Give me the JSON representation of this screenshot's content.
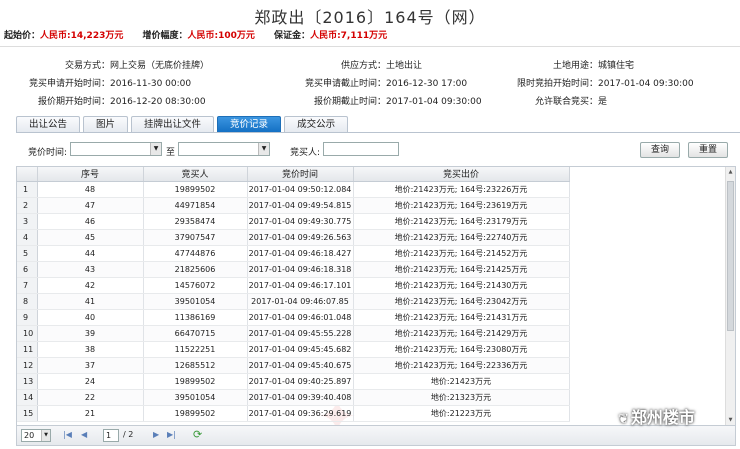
{
  "title": "郑政出〔2016〕164号（网）",
  "summary": {
    "start_price_label": "起始价：",
    "start_price_value": "人民币:14,223万元",
    "increment_label": "增价幅度：",
    "increment_value": "人民币:100万元",
    "deposit_label": "保证金：",
    "deposit_value": "人民币:7,111万元"
  },
  "info": {
    "trade_method_label": "交易方式：",
    "trade_method_value": "网上交易（无底价挂牌）",
    "supply_method_label": "供应方式：",
    "supply_method_value": "土地出让",
    "land_use_label": "土地用途：",
    "land_use_value": "城镇住宅",
    "apply_start_label": "竞买申请开始时间：",
    "apply_start_value": "2016-11-30 00:00",
    "apply_end_label": "竞买申请截止时间：",
    "apply_end_value": "2016-12-30 17:00",
    "timed_start_label": "限时竞拍开始时间：",
    "timed_start_value": "2017-01-04 09:30:00",
    "quote_start_label": "报价期开始时间：",
    "quote_start_value": "2016-12-20 08:30:00",
    "quote_end_label": "报价期截止时间：",
    "quote_end_value": "2017-01-04 09:30:00",
    "joint_label": "允许联合竞买：",
    "joint_value": "是"
  },
  "tabs": [
    "出让公告",
    "图片",
    "挂牌出让文件",
    "竞价记录",
    "成交公示"
  ],
  "active_tab": 3,
  "filter": {
    "time_label": "竞价时间:",
    "to_label": "至",
    "bidder_label": "竞买人:",
    "search_label": "查询",
    "reset_label": "重置"
  },
  "table": {
    "headers": [
      "",
      "序号",
      "竞买人",
      "竞价时间",
      "竞买出价"
    ],
    "rows": [
      [
        "1",
        "48",
        "19899502",
        "2017-01-04 09:50:12.084",
        "地价:21423万元; 164号:23226万元"
      ],
      [
        "2",
        "47",
        "44971854",
        "2017-01-04 09:49:54.815",
        "地价:21423万元; 164号:23619万元"
      ],
      [
        "3",
        "46",
        "29358474",
        "2017-01-04 09:49:30.775",
        "地价:21423万元; 164号:23179万元"
      ],
      [
        "4",
        "45",
        "37907547",
        "2017-01-04 09:49:26.563",
        "地价:21423万元; 164号:22740万元"
      ],
      [
        "5",
        "44",
        "47744876",
        "2017-01-04 09:46:18.427",
        "地价:21423万元; 164号:21452万元"
      ],
      [
        "6",
        "43",
        "21825606",
        "2017-01-04 09:46:18.318",
        "地价:21423万元; 164号:21425万元"
      ],
      [
        "7",
        "42",
        "14576072",
        "2017-01-04 09:46:17.101",
        "地价:21423万元; 164号:21430万元"
      ],
      [
        "8",
        "41",
        "39501054",
        "2017-01-04 09:46:07.85",
        "地价:21423万元; 164号:23042万元"
      ],
      [
        "9",
        "40",
        "11386169",
        "2017-01-04 09:46:01.048",
        "地价:21423万元; 164号:21431万元"
      ],
      [
        "10",
        "39",
        "66470715",
        "2017-01-04 09:45:55.228",
        "地价:21423万元; 164号:21429万元"
      ],
      [
        "11",
        "38",
        "11522251",
        "2017-01-04 09:45:45.682",
        "地价:21423万元; 164号:23080万元"
      ],
      [
        "12",
        "37",
        "12685512",
        "2017-01-04 09:45:40.675",
        "地价:21423万元; 164号:22336万元"
      ],
      [
        "13",
        "24",
        "19899502",
        "2017-01-04 09:40:25.897",
        "地价:21423万元"
      ],
      [
        "14",
        "22",
        "39501054",
        "2017-01-04 09:39:40.408",
        "地价:21323万元"
      ],
      [
        "15",
        "21",
        "19899502",
        "2017-01-04 09:36:29.619",
        "地价:21223万元"
      ]
    ]
  },
  "pager": {
    "page_size": "20",
    "current_page": "1",
    "total_text": "/ 2"
  },
  "watermark": "郑州楼市"
}
